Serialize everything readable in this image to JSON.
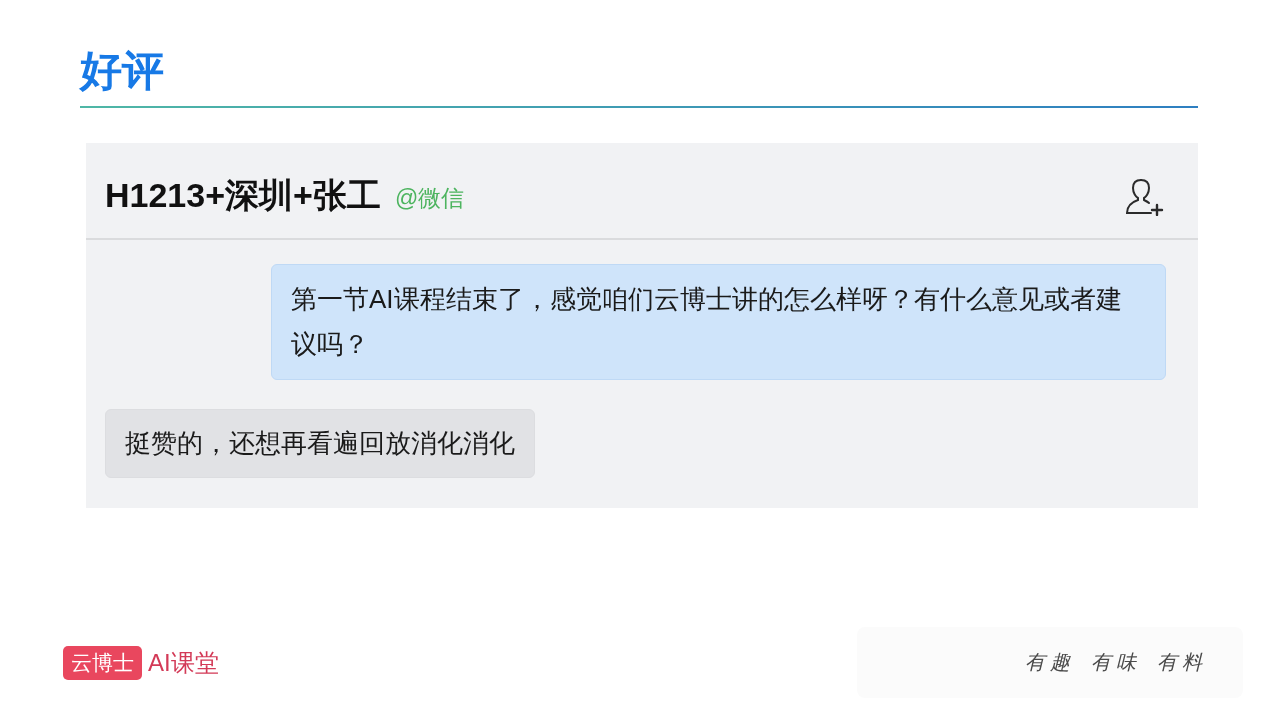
{
  "slide": {
    "title": "好评"
  },
  "chat": {
    "contact_name": "H1213+深圳+张工",
    "contact_source": "@微信",
    "messages": [
      {
        "kind": "sent",
        "text": "第一节AI课程结束了，感觉咱们云博士讲的怎么样呀？有什么意见或者建议吗？"
      },
      {
        "kind": "received",
        "text": "挺赞的，还想再看遍回放消化消化"
      }
    ]
  },
  "footer": {
    "logo_badge": "云博士",
    "logo_text": "AI课堂",
    "slogan": [
      "有趣",
      "有味",
      "有料"
    ]
  }
}
